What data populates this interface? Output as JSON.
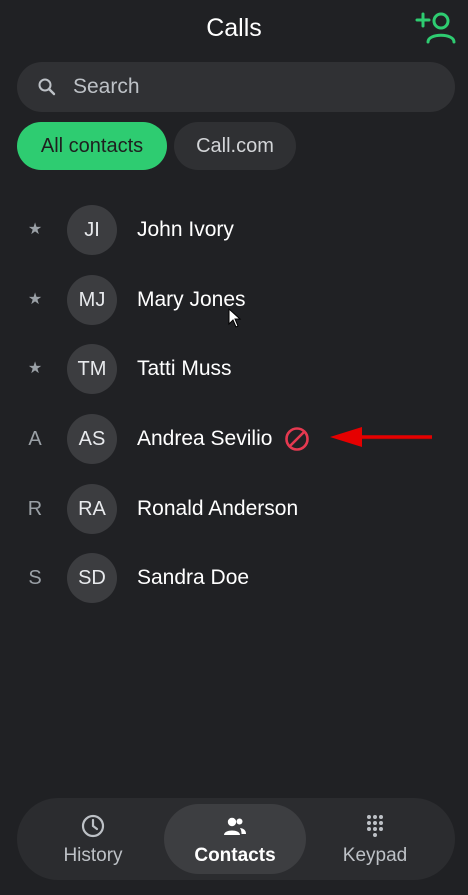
{
  "header": {
    "title": "Calls"
  },
  "search": {
    "placeholder": "Search"
  },
  "filters": [
    {
      "label": "All contacts",
      "active": true
    },
    {
      "label": "Call.com",
      "active": false
    }
  ],
  "contacts": [
    {
      "marker": "★",
      "initials": "JI",
      "name": "John Ivory",
      "blocked": false
    },
    {
      "marker": "★",
      "initials": "MJ",
      "name": "Mary Jones",
      "blocked": false
    },
    {
      "marker": "★",
      "initials": "TM",
      "name": "Tatti Muss",
      "blocked": false
    },
    {
      "marker": "A",
      "initials": "AS",
      "name": "Andrea Sevilio",
      "blocked": true
    },
    {
      "marker": "R",
      "initials": "RA",
      "name": "Ronald Anderson",
      "blocked": false
    },
    {
      "marker": "S",
      "initials": "SD",
      "name": "Sandra Doe",
      "blocked": false
    }
  ],
  "bottom_nav": {
    "history": "History",
    "contacts": "Contacts",
    "keypad": "Keypad",
    "active": "contacts"
  },
  "icons": {
    "add_contact": "person-add-icon",
    "search": "search-icon",
    "blocked": "blocked-icon",
    "history": "clock-icon",
    "contacts": "people-icon",
    "keypad": "dialpad-icon"
  },
  "colors": {
    "background": "#202124",
    "accent": "#2ecc71",
    "blocked": "#e53950",
    "annotation_arrow": "#e60000"
  }
}
